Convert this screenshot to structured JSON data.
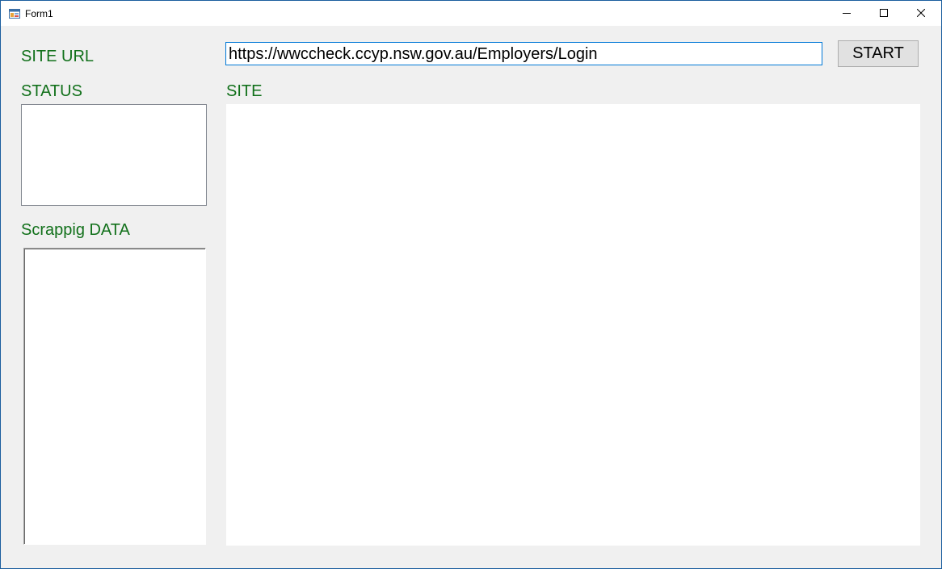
{
  "window": {
    "title": "Form1",
    "icons": {
      "app": "form-app-icon",
      "minimize": "minimize-icon",
      "maximize": "maximize-icon",
      "close": "close-icon"
    }
  },
  "form": {
    "site_url_label": "SITE URL",
    "url_value": "https://wwccheck.ccyp.nsw.gov.au/Employers/Login",
    "start_label": "START",
    "status_label": "STATUS",
    "site_label": "SITE",
    "scrapping_label": "Scrappig DATA"
  },
  "colors": {
    "label_green": "#11701a",
    "input_focus_border": "#0078d7",
    "form_background": "#f0f0f0"
  }
}
